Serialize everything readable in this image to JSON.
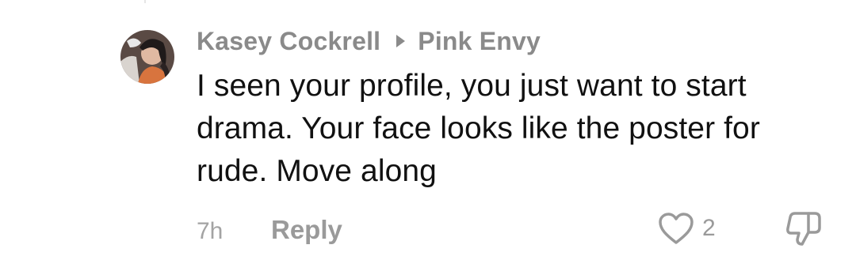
{
  "comment": {
    "author": "Kasey Cockrell",
    "reply_to": "Pink Envy",
    "text": "I seen your profile, you just want to start drama. Your face looks like the poster for rude. Move along",
    "time": "7h",
    "reply_label": "Reply",
    "like_count": "2"
  },
  "icons": {
    "separator": "triangle-right-icon",
    "like": "heart-outline-icon",
    "dislike": "thumbs-down-outline-icon"
  },
  "colors": {
    "meta_text": "#8a8a8a",
    "body_text": "#111111",
    "muted": "#9a9a9a"
  }
}
